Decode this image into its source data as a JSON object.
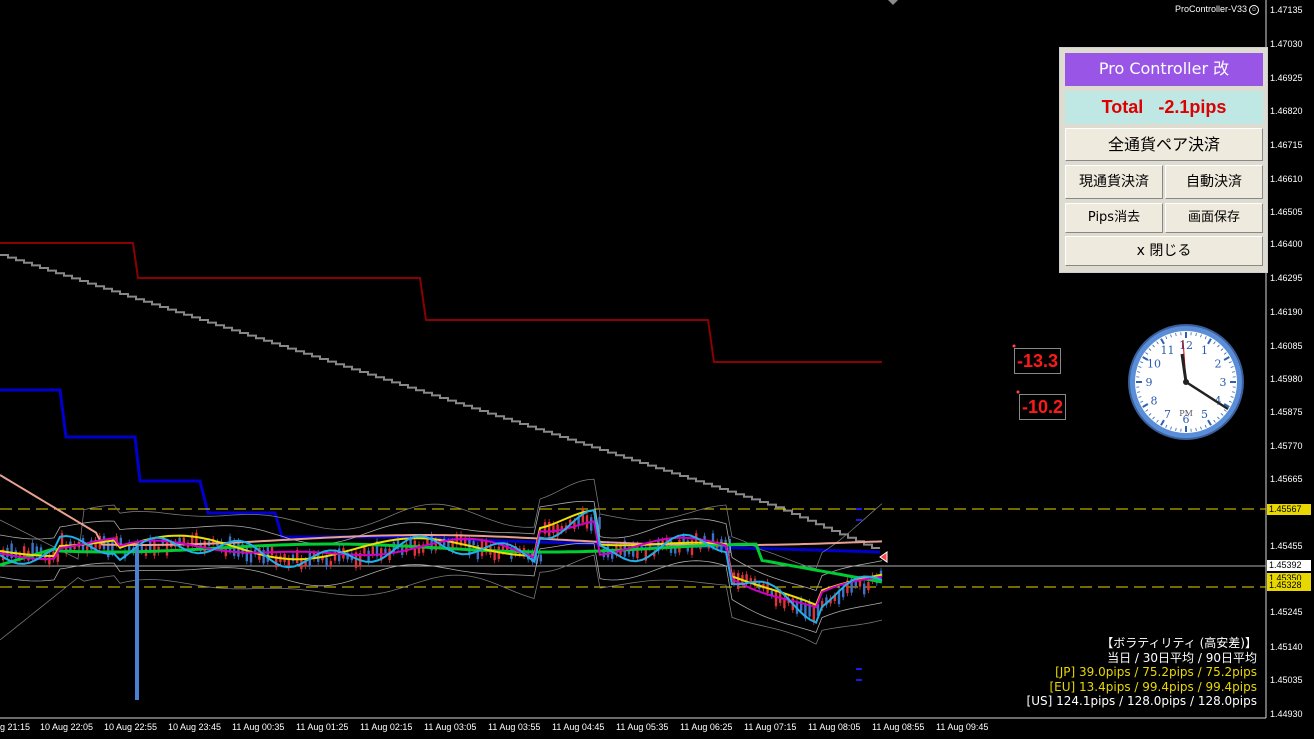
{
  "header": {
    "indicator_label": "ProController-V33",
    "smiley": "☺"
  },
  "price_axis": {
    "ticks": [
      "1.47135",
      "1.47030",
      "1.46925",
      "1.46820",
      "1.46715",
      "1.46610",
      "1.46505",
      "1.46400",
      "1.46295",
      "1.46190",
      "1.46085",
      "1.45980",
      "1.45875",
      "1.45770",
      "1.45665",
      "1.45455",
      "1.45245",
      "1.45140",
      "1.45035",
      "1.44930"
    ],
    "flags": [
      {
        "label": "1.45567",
        "color": "#e8d800",
        "text_color": "#000"
      },
      {
        "label": "1.45392",
        "color": "#ffffff",
        "text_color": "#000"
      },
      {
        "label": "1.45350",
        "color": "#e8d800",
        "text_color": "#000"
      },
      {
        "label": "1.45328",
        "color": "#e8d800",
        "text_color": "#000"
      }
    ]
  },
  "time_axis": [
    "g 21:15",
    "10 Aug 22:05",
    "10 Aug 22:55",
    "10 Aug 23:45",
    "11 Aug 00:35",
    "11 Aug 01:25",
    "11 Aug 02:15",
    "11 Aug 03:05",
    "11 Aug 03:55",
    "11 Aug 04:45",
    "11 Aug 05:35",
    "11 Aug 06:25",
    "11 Aug 07:15",
    "11 Aug 08:05",
    "11 Aug 08:55",
    "11 Aug 09:45"
  ],
  "panel": {
    "title": "Pro Controller 改",
    "total_label": "Total",
    "total_value": "-2.1pips",
    "btn_close_all_pairs": "全通貨ペア決済",
    "btn_close_current": "現通貨決済",
    "btn_auto_close": "自動決済",
    "btn_clear_pips": "Pips消去",
    "btn_save_screen": "画面保存",
    "btn_close": "x 閉じる"
  },
  "pips_labels": [
    "-13.3",
    "-10.2"
  ],
  "clock": {
    "period": "PM",
    "hours": [
      "12",
      "1",
      "2",
      "3",
      "4",
      "5",
      "6",
      "7",
      "8",
      "9",
      "10",
      "11"
    ]
  },
  "volatility": {
    "title": "【ボラティリティ (高安差)】",
    "header": "当日 / 30日平均 / 90日平均",
    "jp": "[JP] 39.0pips / 75.2pips / 75.2pips",
    "eu": "[EU] 13.4pips / 99.4pips / 99.4pips",
    "us": "[US] 124.1pips / 128.0pips / 128.0pips"
  },
  "colors": {
    "accent_purple": "#9955e6",
    "total_bg": "#bfe8e4",
    "loss_red": "#dd0000",
    "level_yellow": "#e8d800"
  }
}
